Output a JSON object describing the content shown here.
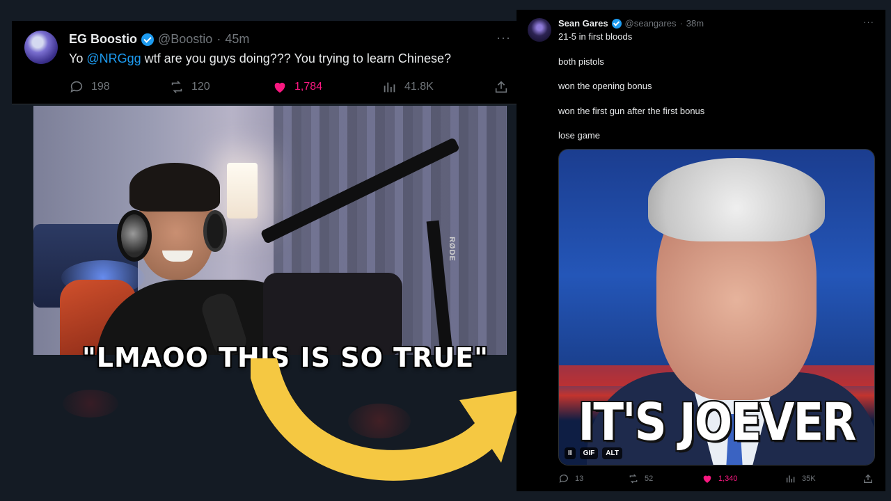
{
  "left_tweet": {
    "display_name": "EG Boostio",
    "handle": "@Boostio",
    "dot": "·",
    "time": "45m",
    "more": "···",
    "text_prefix": "Yo ",
    "mention": "@NRGgg",
    "text_suffix": " wtf are you guys doing??? You trying to learn Chinese?",
    "replies": "198",
    "reposts": "120",
    "likes": "1,784",
    "views": "41.8K"
  },
  "webcam": {
    "mic_brand": "RØDE"
  },
  "caption": "\"LMAOO THIS IS SO TRUE\"",
  "right_tweet": {
    "display_name": "Sean Gares",
    "handle": "@seangares",
    "dot": "·",
    "time": "38m",
    "more": "···",
    "lines": [
      "21-5 in first bloods",
      "both pistols",
      "won the opening bonus",
      "won the first gun after the first bonus",
      "lose game"
    ],
    "gif_caption": "IT'S JOEVER",
    "gif_controls": {
      "pause": "II",
      "gif": "GIF",
      "alt": "ALT"
    },
    "replies": "13",
    "reposts": "52",
    "likes": "1,340",
    "views": "35K"
  },
  "colors": {
    "accent": "#1d9bf0",
    "like": "#f91880",
    "muted": "#71767b",
    "arrow": "#f5c842"
  }
}
